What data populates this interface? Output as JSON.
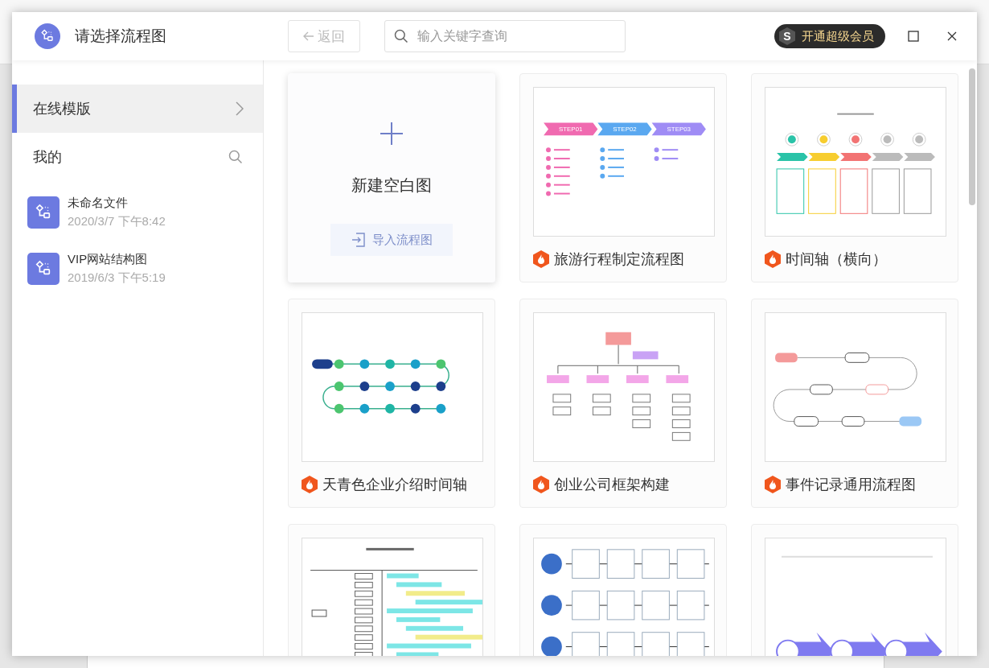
{
  "dialog": {
    "title": "请选择流程图",
    "back_button": {
      "label": "返回",
      "disabled": true
    },
    "search": {
      "placeholder": "输入关键字查询"
    },
    "vip_button": {
      "logo": "S",
      "label": "开通超级会员"
    }
  },
  "sidebar": {
    "items": [
      {
        "label": "在线模版",
        "kind": "link",
        "selected": true
      },
      {
        "label": "我的",
        "kind": "search",
        "selected": false
      }
    ],
    "files": [
      {
        "name": "未命名文件",
        "date": "2020/3/7 下午8:42"
      },
      {
        "name": "VIP网站结构图",
        "date": "2019/6/3 下午5:19"
      }
    ]
  },
  "new_card": {
    "label": "新建空白图",
    "import_button": "导入流程图"
  },
  "templates": [
    {
      "title": "旅游行程制定流程图",
      "kind": "steps",
      "steps": [
        "STEP01",
        "STEP02",
        "STEP03"
      ]
    },
    {
      "title": "时间轴（横向）",
      "kind": "timeline"
    },
    {
      "title": "天青色企业介绍时间轴",
      "kind": "loop"
    },
    {
      "title": "创业公司框架构建",
      "kind": "org"
    },
    {
      "title": "事件记录通用流程图",
      "kind": "flow"
    },
    {
      "kind": "gantt"
    },
    {
      "kind": "swimlane"
    },
    {
      "kind": "arrows"
    }
  ]
}
